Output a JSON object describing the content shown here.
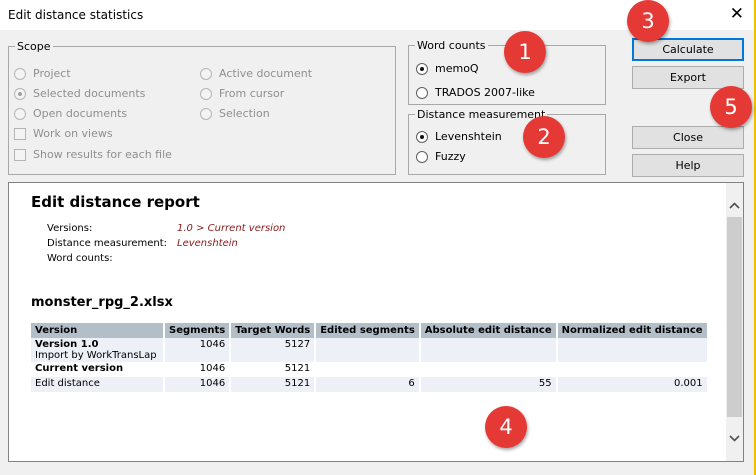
{
  "window": {
    "title": "Edit distance statistics",
    "close_symbol": "✕"
  },
  "scope": {
    "legend": "Scope",
    "options": [
      {
        "label": "Project",
        "type": "radio",
        "selected": false
      },
      {
        "label": "Selected documents",
        "type": "radio",
        "selected": true
      },
      {
        "label": "Open documents",
        "type": "radio",
        "selected": false
      },
      {
        "label": "Active document",
        "type": "radio",
        "selected": false
      },
      {
        "label": "From cursor",
        "type": "radio",
        "selected": false
      },
      {
        "label": "Selection",
        "type": "radio",
        "selected": false
      },
      {
        "label": "Work on views",
        "type": "checkbox",
        "checked": false
      },
      {
        "label": "Show results for each file",
        "type": "checkbox",
        "checked": false
      }
    ]
  },
  "word_counts": {
    "legend": "Word counts",
    "options": [
      {
        "label": "memoQ",
        "selected": true
      },
      {
        "label": "TRADOS 2007-like",
        "selected": false
      }
    ]
  },
  "distance_measurement": {
    "legend": "Distance measurement",
    "options": [
      {
        "label": "Levenshtein",
        "selected": true
      },
      {
        "label": "Fuzzy",
        "selected": false
      }
    ]
  },
  "buttons": {
    "calculate": "Calculate",
    "export": "Export",
    "close": "Close",
    "help": "Help"
  },
  "report": {
    "title": "Edit distance report",
    "meta": [
      {
        "label": "Versions:",
        "value": "1.0 > Current version"
      },
      {
        "label": "Distance measurement:",
        "value": "Levenshtein"
      },
      {
        "label": "Word counts:",
        "value": ""
      }
    ],
    "file_name": "monster_rpg_2.xlsx",
    "table": {
      "headers": [
        "Version",
        "Segments",
        "Target Words",
        "Edited segments",
        "Absolute edit distance",
        "Normalized edit distance"
      ],
      "rows": [
        {
          "version": "Version 1.0",
          "sub": "Import by WorkTransLap",
          "segments": "1046",
          "target_words": "5127",
          "edited": "",
          "absolute": "",
          "normalized": ""
        },
        {
          "version": "Current version",
          "sub": "",
          "segments": "1046",
          "target_words": "5121",
          "edited": "",
          "absolute": "",
          "normalized": ""
        },
        {
          "version": "Edit distance",
          "sub": "",
          "segments": "1046",
          "target_words": "5121",
          "edited": "6",
          "absolute": "55",
          "normalized": "0.001"
        }
      ]
    }
  },
  "scroll": {
    "up_icon": "chevron-up",
    "down_icon": "chevron-down"
  },
  "badges": [
    "1",
    "2",
    "3",
    "4",
    "5"
  ],
  "colors": {
    "badge": "#e53935",
    "meta_value": "#8b1a1a",
    "table_header": "#b2bfc9",
    "default_button_border": "#0078d7"
  }
}
